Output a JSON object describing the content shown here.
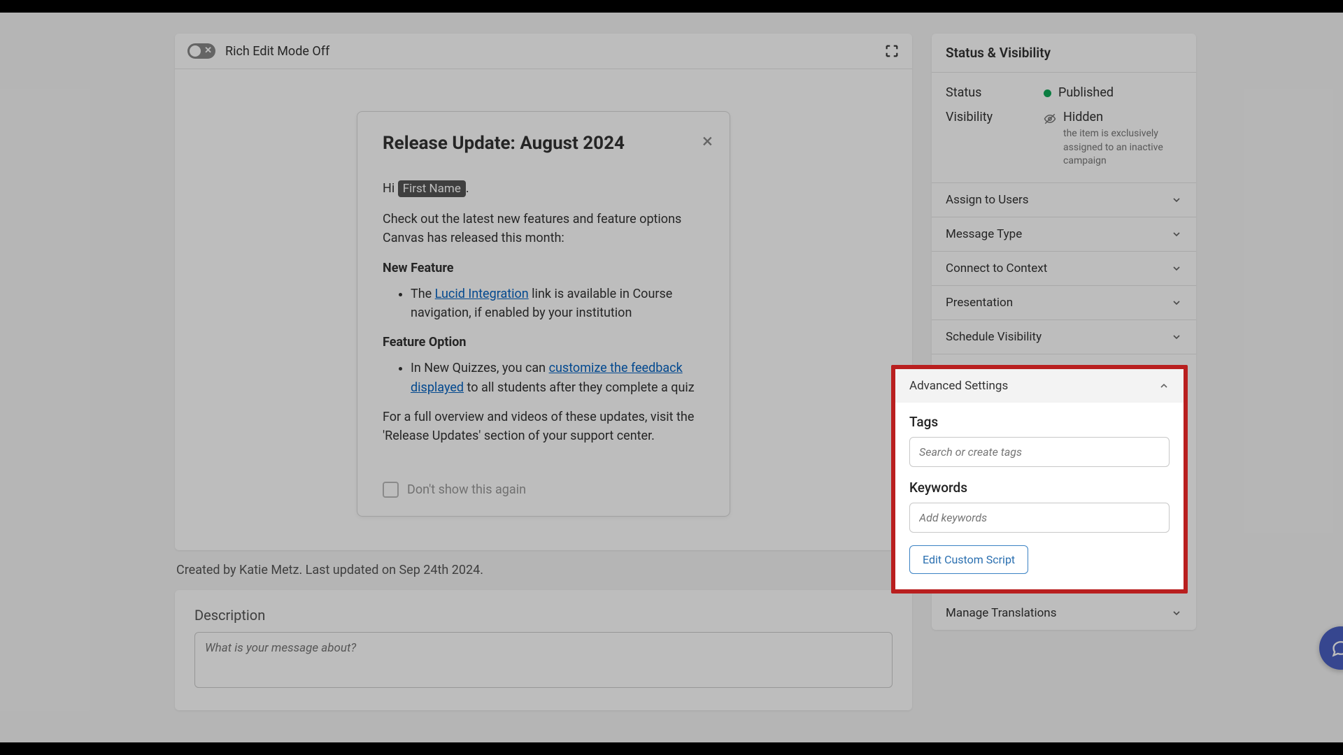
{
  "editor": {
    "rich_edit_label": "Rich Edit Mode Off"
  },
  "preview": {
    "title": "Release Update: August 2024",
    "greeting_hi": "Hi ",
    "greeting_token": "First Name",
    "intro": "Check out the latest new features and feature options Canvas has released this month:",
    "heading_feature": "New Feature",
    "feature_bullet_pre": "The ",
    "feature_link": "Lucid Integration",
    "feature_bullet_post": " link is available in Course navigation, if enabled by your institution",
    "heading_option": "Feature Option",
    "option_bullet_pre": "In New Quizzes, you can ",
    "option_link": "customize the feedback displayed",
    "option_bullet_post": " to all students after they complete a quiz",
    "closing": "For a full overview and videos of these updates, visit the 'Release Updates' section of your support center.",
    "dont_show": "Don't show this again"
  },
  "meta": {
    "line": "Created by Katie Metz. Last updated on Sep 24th 2024."
  },
  "description": {
    "label": "Description",
    "placeholder": "What is your message about?"
  },
  "sidebar": {
    "status_visibility_title": "Status & Visibility",
    "status_label": "Status",
    "status_value": "Published",
    "visibility_label": "Visibility",
    "visibility_value": "Hidden",
    "visibility_note": "the item is exclusively assigned to an inactive campaign",
    "accordion": [
      "Assign to Users",
      "Message Type",
      "Connect to Context",
      "Presentation",
      "Schedule Visibility"
    ],
    "manage_translations": "Manage Translations"
  },
  "advanced": {
    "title": "Advanced Settings",
    "tags_label": "Tags",
    "tags_placeholder": "Search or create tags",
    "keywords_label": "Keywords",
    "keywords_placeholder": "Add keywords",
    "edit_script": "Edit Custom Script"
  }
}
